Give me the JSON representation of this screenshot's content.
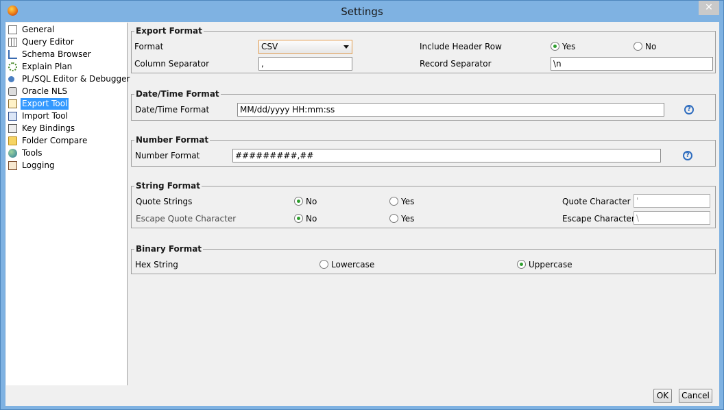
{
  "window": {
    "title": "Settings",
    "close_glyph": "✕"
  },
  "nav": {
    "selected": "Export Tool",
    "items": [
      {
        "label": "General",
        "icon": "general-icon"
      },
      {
        "label": "Query Editor",
        "icon": "query-editor-icon"
      },
      {
        "label": "Schema Browser",
        "icon": "schema-browser-icon"
      },
      {
        "label": "Explain Plan",
        "icon": "explain-plan-icon"
      },
      {
        "label": "PL/SQL Editor & Debugger",
        "icon": "debugger-icon"
      },
      {
        "label": "Oracle NLS",
        "icon": "oracle-nls-icon"
      },
      {
        "label": "Export Tool",
        "icon": "export-tool-icon"
      },
      {
        "label": "Import Tool",
        "icon": "import-tool-icon"
      },
      {
        "label": "Key Bindings",
        "icon": "key-bindings-icon"
      },
      {
        "label": "Folder Compare",
        "icon": "folder-compare-icon"
      },
      {
        "label": "Tools",
        "icon": "tools-icon"
      },
      {
        "label": "Logging",
        "icon": "logging-icon"
      }
    ]
  },
  "export_format": {
    "title": "Export Format",
    "format_label": "Format",
    "format_value": "CSV",
    "header_row_label": "Include Header Row",
    "header_yes": "Yes",
    "header_no": "No",
    "header_selected": "Yes",
    "column_sep_label": "Column Separator",
    "column_sep_value": ",",
    "record_sep_label": "Record Separator",
    "record_sep_value": "\\n"
  },
  "datetime_format": {
    "title": "Date/Time Format",
    "label": "Date/Time Format",
    "value": "MM/dd/yyyy HH:mm:ss",
    "help_glyph": "?"
  },
  "number_format": {
    "title": "Number Format",
    "label": "Number Format",
    "value": "#########,##",
    "help_glyph": "?"
  },
  "string_format": {
    "title": "String Format",
    "quote_strings_label": "Quote Strings",
    "quote_no": "No",
    "quote_yes": "Yes",
    "quote_selected": "No",
    "quote_char_label": "Quote Character",
    "quote_char_value": "'",
    "escape_quote_label": "Escape Quote Character",
    "escape_no": "No",
    "escape_yes": "Yes",
    "escape_selected": "No",
    "escape_char_label": "Escape Character",
    "escape_char_value": "\\"
  },
  "binary_format": {
    "title": "Binary Format",
    "hex_label": "Hex String",
    "lowercase": "Lowercase",
    "uppercase": "Uppercase",
    "selected": "Uppercase"
  },
  "buttons": {
    "ok": "OK",
    "cancel": "Cancel"
  }
}
